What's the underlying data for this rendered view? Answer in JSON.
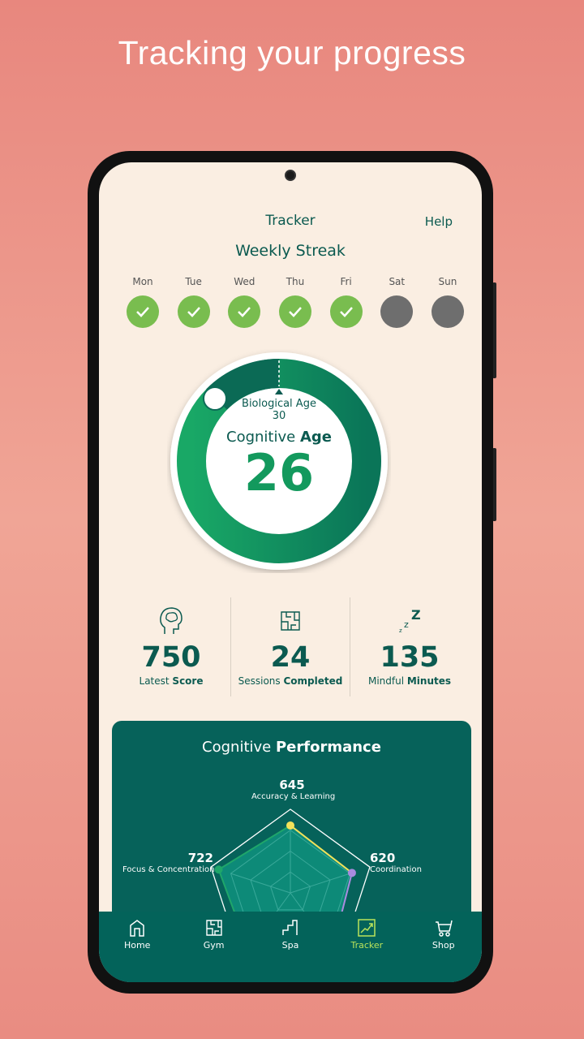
{
  "headline": "Tracking your progress",
  "header": {
    "title": "Tracker",
    "help": "Help"
  },
  "streak": {
    "title": "Weekly Streak",
    "days": [
      {
        "label": "Mon",
        "done": true
      },
      {
        "label": "Tue",
        "done": true
      },
      {
        "label": "Wed",
        "done": true
      },
      {
        "label": "Thu",
        "done": true
      },
      {
        "label": "Fri",
        "done": true
      },
      {
        "label": "Sat",
        "done": false
      },
      {
        "label": "Sun",
        "done": false
      }
    ],
    "done_color": "#79bd4f",
    "missed_color": "#6e6e6e"
  },
  "age": {
    "bio_label": "Biological Age",
    "bio_value": "30",
    "cog_label_a": "Cognitive ",
    "cog_label_b": "Age",
    "cog_value": "26",
    "ring_color": "#0f7f5c"
  },
  "stats": [
    {
      "icon": "brain-head-icon",
      "value": "750",
      "label_a": "Latest ",
      "label_b": "Score"
    },
    {
      "icon": "maze-icon",
      "value": "24",
      "label_a": "Sessions ",
      "label_b": "Completed"
    },
    {
      "icon": "sleep-zzz-icon",
      "value": "135",
      "label_a": "Mindful ",
      "label_b": "Minutes"
    }
  ],
  "performance": {
    "title_a": "Cognitive ",
    "title_b": "Performance"
  },
  "chart_data": {
    "type": "radar",
    "max": 800,
    "axes": [
      {
        "label": "Accuracy & Learning",
        "value": 645,
        "color": "#f2e25a"
      },
      {
        "label": "Coordination",
        "value": 620,
        "color": "#a98be0"
      },
      {
        "label": "Focus & Concentration",
        "value": 722,
        "color": "#1fa66a"
      }
    ]
  },
  "nav": [
    {
      "label": "Home",
      "icon": "home-icon"
    },
    {
      "label": "Gym",
      "icon": "maze-icon"
    },
    {
      "label": "Spa",
      "icon": "stairs-icon"
    },
    {
      "label": "Tracker",
      "icon": "chart-up-icon",
      "active": true
    },
    {
      "label": "Shop",
      "icon": "cart-icon"
    }
  ]
}
